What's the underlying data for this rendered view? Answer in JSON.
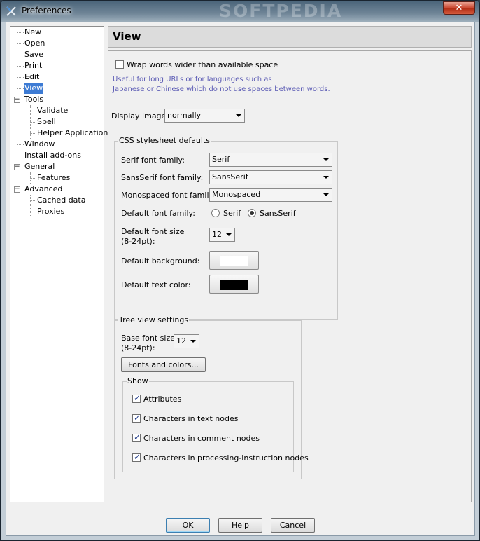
{
  "window": {
    "title": "Preferences",
    "watermark": "SOFTPEDIA",
    "close_glyph": "✕"
  },
  "tree": {
    "items": [
      {
        "label": "New"
      },
      {
        "label": "Open"
      },
      {
        "label": "Save"
      },
      {
        "label": "Print"
      },
      {
        "label": "Edit"
      },
      {
        "label": "View",
        "selected": true
      },
      {
        "label": "Tools"
      },
      {
        "label": "Validate"
      },
      {
        "label": "Spell"
      },
      {
        "label": "Helper Applications"
      },
      {
        "label": "Window"
      },
      {
        "label": "Install add-ons"
      },
      {
        "label": "General"
      },
      {
        "label": "Features"
      },
      {
        "label": "Advanced"
      },
      {
        "label": "Cached data"
      },
      {
        "label": "Proxies"
      }
    ],
    "expander_glyph": "−"
  },
  "panel": {
    "title": "View",
    "wrap": {
      "label": "Wrap words wider than available space",
      "checked": false,
      "hint_line1": "Useful for long URLs or for languages such as",
      "hint_line2": "Japanese or Chinese which do not use spaces between words."
    },
    "display_images": {
      "label": "Display images",
      "value": "normally"
    },
    "css": {
      "title": "CSS stylesheet defaults",
      "serif_label": "Serif font family:",
      "serif_value": "Serif",
      "sans_label": "SansSerif font family:",
      "sans_value": "SansSerif",
      "mono_label": "Monospaced font family:",
      "mono_value": "Monospaced",
      "default_family_label": "Default font family:",
      "radio_serif": "Serif",
      "radio_sans": "SansSerif",
      "selected_family": "SansSerif",
      "size_label_1": "Default font size",
      "size_label_2": "(8-24pt):",
      "size_value": "12",
      "bg_label": "Default background:",
      "bg_color": "#ffffff",
      "text_color_label": "Default text color:",
      "text_color": "#000000"
    },
    "tree_view": {
      "title": "Tree view settings",
      "size_label_1": "Base font size",
      "size_label_2": "(8-24pt):",
      "size_value": "12",
      "fonts_button": "Fonts and colors...",
      "show": {
        "title": "Show",
        "items": [
          {
            "label": "Attributes",
            "checked": true
          },
          {
            "label": "Characters in text nodes",
            "checked": true
          },
          {
            "label": "Characters in comment nodes",
            "checked": true
          },
          {
            "label": "Characters in processing-instruction nodes",
            "checked": true
          }
        ]
      }
    }
  },
  "buttons": {
    "ok": "OK",
    "help": "Help",
    "cancel": "Cancel"
  },
  "colors": {
    "selection": "#3d7bd4",
    "hint_text": "#5a5ab4",
    "close_button": "#c8452e"
  }
}
